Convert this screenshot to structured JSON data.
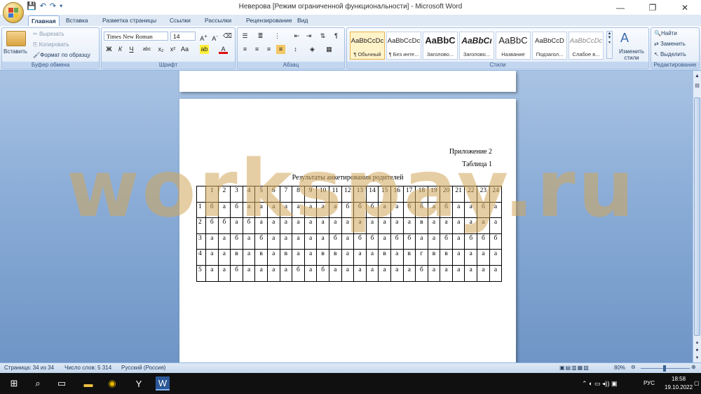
{
  "window": {
    "title": "Неверова [Режим ограниченной функциональности] - Microsoft Word"
  },
  "tabs": [
    "Главная",
    "Вставка",
    "Разметка страницы",
    "Ссылки",
    "Рассылки",
    "Рецензирование",
    "Вид"
  ],
  "ribbon": {
    "clipboard": {
      "label": "Буфер обмена",
      "paste": "Вставить",
      "cut": "Вырезать",
      "copy": "Копировать",
      "format_painter": "Формат по образцу"
    },
    "font": {
      "label": "Шрифт",
      "font_name": "Times New Roman",
      "font_size": "14",
      "bold": "Ж",
      "italic": "К",
      "underline": "Ч"
    },
    "paragraph": {
      "label": "Абзац"
    },
    "styles": {
      "label": "Стили",
      "items": [
        {
          "sample": "AaBbCcDc",
          "name": "¶ Обычный"
        },
        {
          "sample": "AaBbCcDc",
          "name": "¶ Без инте..."
        },
        {
          "sample": "AaBbC",
          "name": "Заголово..."
        },
        {
          "sample": "AaBbCı",
          "name": "Заголово..."
        },
        {
          "sample": "AaBbC",
          "name": "Название"
        },
        {
          "sample": "AaBbCcD",
          "name": "Подзагол..."
        },
        {
          "sample": "AaBbCcDc",
          "name": "Слабое в..."
        }
      ],
      "change_styles": "Изменить стили"
    },
    "editing": {
      "label": "Редактирование",
      "find": "Найти",
      "replace": "Заменить",
      "select": "Выделить"
    }
  },
  "document": {
    "appendix": "Приложение 2",
    "table_label": "Таблица 1",
    "table_title": "Результаты анкетирования родителей",
    "columns": [
      "1",
      "2",
      "3",
      "4",
      "5",
      "6",
      "7",
      "8",
      "9",
      "10",
      "11",
      "12",
      "13",
      "14",
      "15",
      "16",
      "17",
      "18",
      "19",
      "20",
      "21",
      "22",
      "23",
      "24"
    ],
    "rows": [
      {
        "num": "1",
        "cells": [
          "б",
          "а",
          "б",
          "а",
          "а",
          "а",
          "а",
          "а",
          "а",
          "а",
          "а",
          "б",
          "б",
          "б",
          "а",
          "а",
          "б",
          "б",
          "а",
          "б",
          "а",
          "а",
          "б",
          "а"
        ]
      },
      {
        "num": "2",
        "cells": [
          "б",
          "б",
          "а",
          "б",
          "а",
          "а",
          "а",
          "а",
          "а",
          "а",
          "а",
          "а",
          "а",
          "а",
          "а",
          "а",
          "а",
          "в",
          "а",
          "а",
          "а",
          "а",
          "а",
          "а"
        ]
      },
      {
        "num": "3",
        "cells": [
          "а",
          "а",
          "б",
          "а",
          "б",
          "а",
          "а",
          "а",
          "а",
          "а",
          "б",
          "а",
          "б",
          "б",
          "а",
          "б",
          "б",
          "а",
          "а",
          "б",
          "а",
          "б",
          "б",
          "б"
        ]
      },
      {
        "num": "4",
        "cells": [
          "а",
          "а",
          "в",
          "а",
          "в",
          "а",
          "в",
          "а",
          "а",
          "в",
          "в",
          "а",
          "а",
          "а",
          "в",
          "а",
          "в",
          "г",
          "в",
          "в",
          "а",
          "а",
          "а",
          "а"
        ]
      },
      {
        "num": "5",
        "cells": [
          "а",
          "а",
          "б",
          "а",
          "а",
          "а",
          "а",
          "б",
          "а",
          "б",
          "а",
          "а",
          "а",
          "а",
          "а",
          "а",
          "а",
          "б",
          "а",
          "а",
          "а",
          "а",
          "а",
          "а"
        ]
      }
    ],
    "watermark": "workspay.ru"
  },
  "status": {
    "page": "Страница: 34 из 34",
    "words": "Число слов: 5 314",
    "language": "Русский (Россия)",
    "zoom": "80%"
  },
  "taskbar": {
    "lang": "РУС",
    "time": "18:58",
    "date": "19.10.2022"
  }
}
